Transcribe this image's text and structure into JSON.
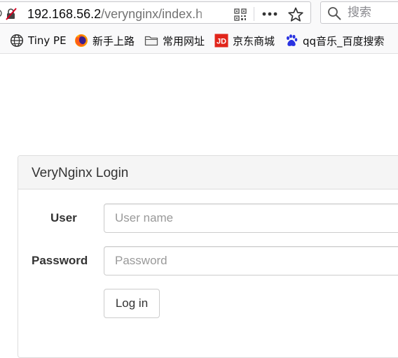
{
  "browser": {
    "url_host": "192.168.56.2",
    "url_path": "/verynginx/index.h",
    "search_placeholder": "搜索"
  },
  "bookmarks": [
    {
      "label": "Tiny PE",
      "icon": "globe-icon"
    },
    {
      "label": "新手上路",
      "icon": "firefox-icon"
    },
    {
      "label": "常用网址",
      "icon": "folder-icon"
    },
    {
      "label": "京东商城",
      "icon": "jd-icon"
    },
    {
      "label": "qq音乐_百度搜索",
      "icon": "baidu-paw-icon"
    }
  ],
  "login": {
    "title": "VeryNginx Login",
    "user_label": "User",
    "user_placeholder": "User name",
    "password_label": "Password",
    "password_placeholder": "Password",
    "submit_label": "Log in"
  },
  "colors": {
    "jd_red": "#e1251b",
    "baidu_blue": "#2932e1",
    "panel_heading_bg": "#f5f5f5"
  }
}
